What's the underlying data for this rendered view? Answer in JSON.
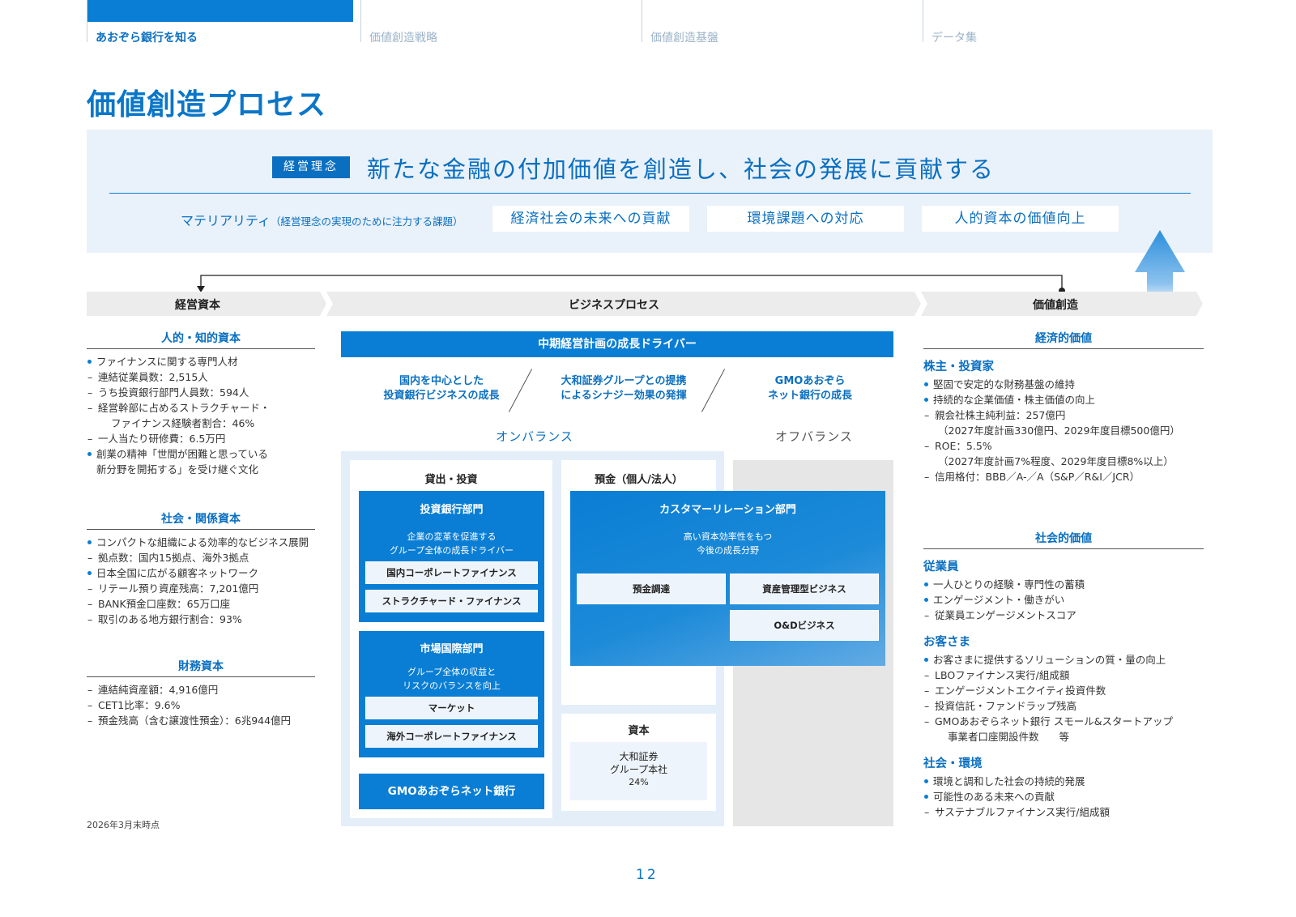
{
  "nav": {
    "tabs": [
      {
        "label": "あおぞら銀行を知る"
      },
      {
        "label": "価値創造戦略"
      },
      {
        "label": "価値創造基盤"
      },
      {
        "label": "データ集"
      }
    ]
  },
  "title": "価値創造プロセス",
  "philosophy": {
    "badge": "経営理念",
    "text": "新たな金融の付加価値を創造し、社会の発展に貢献する"
  },
  "materiality": {
    "label": "マテリアリティ",
    "note": "（経営理念の実現のために注力する課題）",
    "items": [
      "経済社会の未来への貢献",
      "環境課題への対応",
      "人的資本の価値向上"
    ]
  },
  "flow": {
    "capital": "経営資本",
    "process": "ビジネスプロセス",
    "value": "価値創造"
  },
  "capitals": {
    "human": {
      "title": "人的・知的資本",
      "b1": "ファイナンスに関する専門人材",
      "d1": "連結従業員数：2,515人",
      "d2": "うち投資銀行部門人員数：594人",
      "d3": "経営幹部に占めるストラクチャード・",
      "d3b": "ファイナンス経験者割合：46%",
      "d4": "一人当たり研修費：6.5万円",
      "b2": "創業の精神「世間が困難と思っている",
      "b2b": "新分野を開拓する」を受け継ぐ文化"
    },
    "social": {
      "title": "社会・関係資本",
      "b1": "コンパクトな組織による効率的なビジネス展開",
      "d1": "拠点数：国内15拠点、海外3拠点",
      "b2": "日本全国に広がる顧客ネットワーク",
      "d2": "リテール預り資産残高：7,201億円",
      "d3": "BANK預金口座数：65万口座",
      "d4": "取引のある地方銀行割合：93%"
    },
    "financial": {
      "title": "財務資本",
      "d1": "連結純資産額：4,916億円",
      "d2": "CET1比率：9.6%",
      "d3": "預金残高（含む譲渡性預金）：6兆944億円"
    },
    "footnote": "2026年3月末時点"
  },
  "business": {
    "driver_title": "中期経営計画の成長ドライバー",
    "drivers": [
      {
        "l1": "国内を中心とした",
        "l2": "投資銀行ビジネスの成長"
      },
      {
        "l1": "大和証券グループとの提携",
        "l2": "によるシナジー効果の発揮"
      },
      {
        "l1": "GMOあおぞら",
        "l2": "ネット銀行の成長"
      }
    ],
    "on_balance": "オンバランス",
    "off_balance": "オフバランス",
    "lending": {
      "head": "貸出・投資",
      "ib": {
        "title": "投資銀行部門",
        "desc1": "企業の変革を促進する",
        "desc2": "グループ全体の成長ドライバー",
        "items": [
          "国内コーポレートファイナンス",
          "ストラクチャード・ファイナンス"
        ]
      },
      "market": {
        "title": "市場国際部門",
        "desc1": "グループ全体の収益と",
        "desc2": "リスクのバランスを向上",
        "items": [
          "マーケット",
          "海外コーポレートファイナンス"
        ]
      },
      "gmo": "GMOあおぞらネット銀行"
    },
    "deposit": {
      "head": "預金（個人/法人）",
      "cr": {
        "title": "カスタマーリレーション部門",
        "desc1": "高い資本効率性をもつ",
        "desc2": "今後の成長分野",
        "items": [
          "預金調達",
          "資産管理型ビジネス",
          "O&Dビジネス"
        ]
      }
    },
    "capital": {
      "head": "資本",
      "l1": "大和証券",
      "l2": "グループ本社",
      "l3": "24%"
    }
  },
  "value": {
    "economic": {
      "title": "経済的価値",
      "sub": "株主・投資家",
      "b1": "堅固で安定的な財務基盤の維持",
      "b2": "持続的な企業価値・株主価値の向上",
      "d1": "親会社株主純利益：257億円",
      "c1": "（2027年度計画330億円、2029年度目標500億円）",
      "d2": "ROE：5.5%",
      "c2": "（2027年度計画7%程度、2029年度目標8%以上）",
      "d3": "信用格付：BBB／A-／A（S&P／R&I／JCR）"
    },
    "social": {
      "title": "社会的価値",
      "emp": "従業員",
      "e_b1": "一人ひとりの経験・専門性の蓄積",
      "e_b2": "エンゲージメント・働きがい",
      "e_d1": "従業員エンゲージメントスコア",
      "cust": "お客さま",
      "c_b1": "お客さまに提供するソリューションの質・量の向上",
      "c_d1": "LBOファイナンス実行/組成額",
      "c_d2": "エンゲージメントエクイティ投資件数",
      "c_d3": "投資信託・ファンドラップ残高",
      "c_d4": "GMOあおぞらネット銀行 スモール&スタートアップ",
      "c_d4b": "事業者口座開設件数　　等",
      "env": "社会・環境",
      "s_b1": "環境と調和した社会の持続的発展",
      "s_b2": "可能性のある未来への貢献",
      "s_d1": "サステナブルファイナンス実行/組成額"
    }
  },
  "page_number": "12",
  "colors": {
    "primary": "#0a7ed4",
    "dark_blue": "#0a6fc0",
    "panel": "#e9f1fa"
  }
}
